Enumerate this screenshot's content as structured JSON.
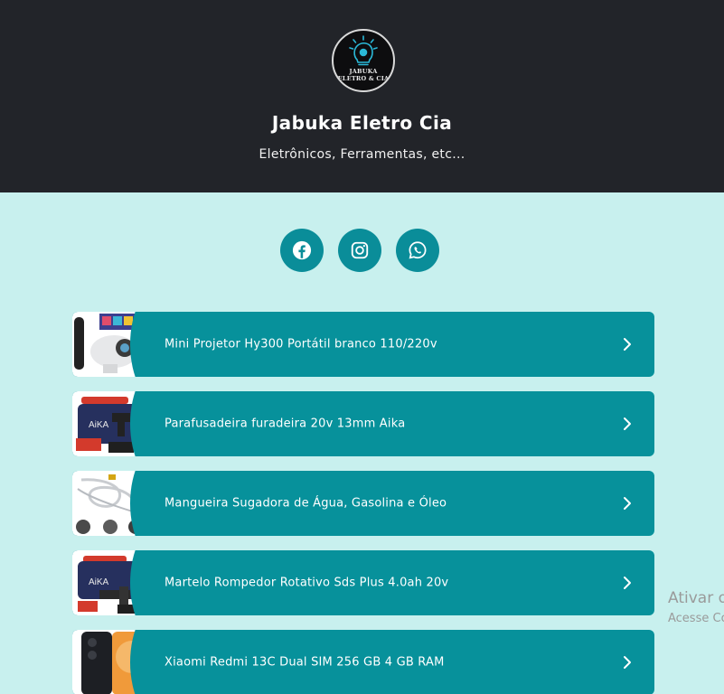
{
  "profile": {
    "logo_line1": "JABUKA",
    "logo_line2": "ELETRO & CIA",
    "name": "Jabuka Eletro Cia",
    "tagline": "Eletrônicos, Ferramentas, etc..."
  },
  "socials": [
    {
      "icon": "facebook-icon"
    },
    {
      "icon": "instagram-icon"
    },
    {
      "icon": "whatsapp-icon"
    }
  ],
  "links": [
    {
      "label": "Mini Projetor Hy300 Portátil branco 110/220v"
    },
    {
      "label": "Parafusadeira furadeira 20v 13mm Aika"
    },
    {
      "label": "Mangueira Sugadora de Água, Gasolina e Óleo"
    },
    {
      "label": "Martelo Rompedor Rotativo Sds Plus 4.0ah 20v"
    },
    {
      "label": "Xiaomi Redmi 13C Dual SIM 256 GB 4 GB RAM"
    }
  ],
  "watermark": {
    "line1": "Ativar o",
    "line2": "Acesse Co"
  },
  "colors": {
    "header_bg": "#222429",
    "page_bg": "#c8f0ee",
    "accent": "#07919b"
  }
}
